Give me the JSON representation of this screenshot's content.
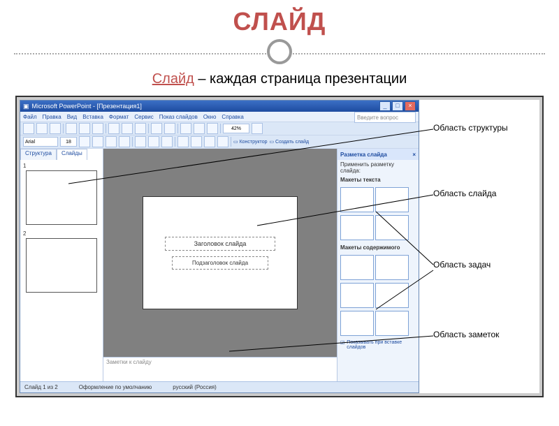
{
  "title": "СЛАЙД",
  "subtitle_red": "Слайд",
  "subtitle_rest": " – каждая страница презентации",
  "ppt": {
    "window_title": "Microsoft PowerPoint - [Презентация1]",
    "menu": [
      "Файл",
      "Правка",
      "Вид",
      "Вставка",
      "Формат",
      "Сервис",
      "Показ слайдов",
      "Окно",
      "Справка"
    ],
    "zoom": "42%",
    "toolbar2_font": "Arial",
    "toolbar2_size": "18",
    "toolbar2_design_label": "Конструктор",
    "toolbar2_newslide_label": "Создать слайд",
    "ask_box": "Введите вопрос",
    "outline_tabs": {
      "struct": "Структура",
      "slides": "Слайды"
    },
    "thumbs": [
      "1",
      "2"
    ],
    "placeholder_title": "Заголовок слайда",
    "placeholder_sub": "Подзаголовок слайда",
    "notes_placeholder": "Заметки к слайду",
    "taskpane": {
      "title": "Разметка слайда",
      "apply_label": "Применить разметку слайда:",
      "section_text": "Макеты текста",
      "section_content": "Макеты содержимого",
      "checkbox_label": "Показывать при вставке слайдов"
    },
    "status": {
      "slide_of": "Слайд 1 из 2",
      "design": "Оформление по умолчанию",
      "lang": "русский (Россия)"
    }
  },
  "callouts": {
    "outline": "Область структуры",
    "slide": "Область слайда",
    "taskpane": "Область задач",
    "notes": "Область заметок"
  }
}
